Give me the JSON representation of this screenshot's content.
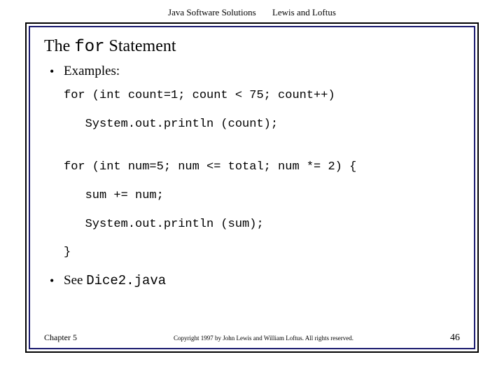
{
  "header": {
    "book": "Java Software Solutions",
    "authors": "Lewis and Loftus"
  },
  "title": {
    "pre": "The ",
    "keyword": "for",
    "post": " Statement"
  },
  "bullets": {
    "examples_label": "Examples:",
    "code1_line1": "for (int count=1; count < 75; count++)",
    "code1_line2": "   System.out.println (count);",
    "code2_line1": "for (int num=5; num <= total; num *= 2) {",
    "code2_line2": "   sum += num;",
    "code2_line3": "   System.out.println (sum);",
    "code2_line4": "}",
    "see_pre": "See ",
    "see_file": "Dice2.java"
  },
  "footer": {
    "chapter": "Chapter 5",
    "copyright": "Copyright 1997 by John Lewis and William Loftus. All rights reserved.",
    "page": "46"
  }
}
